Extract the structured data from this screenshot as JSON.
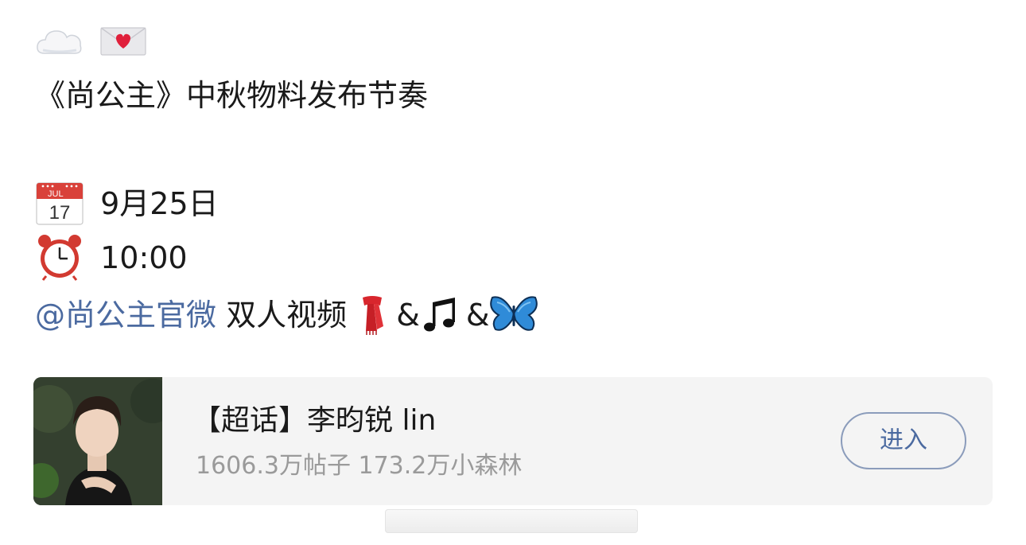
{
  "post": {
    "line1_emojis": [
      "cloud-emoji",
      "love-letter-emoji"
    ],
    "headline": "《尚公主》中秋物料发布节奏",
    "date_icon": "calendar-icon",
    "calendar_month": "JUL",
    "calendar_day": "17",
    "date_text": "9月25日",
    "time_icon": "alarm-clock-icon",
    "time_text": "10:00",
    "mention": "@尚公主官微",
    "content_text": " 双人视频 ",
    "content_emojis": [
      "scarf-emoji",
      "music-notes-emoji",
      "butterfly-emoji"
    ],
    "amp": "&",
    "mention_color": "#4b6aa0"
  },
  "card": {
    "title": "【超话】李昀锐 lin",
    "stats": "1606.3万帖子 173.2万小森林",
    "enter_label": "进入",
    "thumbnail": "avatar-photo"
  }
}
